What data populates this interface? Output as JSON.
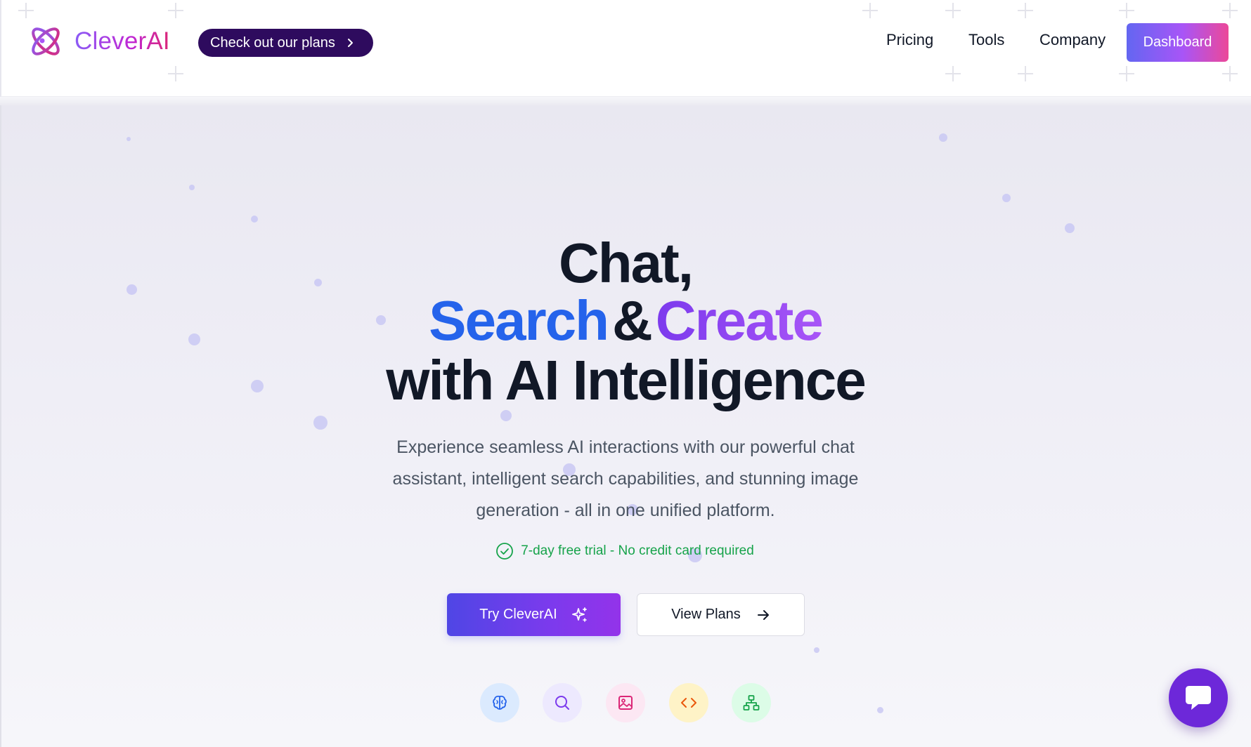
{
  "header": {
    "brand": "CleverAI",
    "plans_pill": "Check out our plans",
    "nav": [
      {
        "label": "Pricing"
      },
      {
        "label": "Tools"
      },
      {
        "label": "Company"
      }
    ],
    "dashboard_label": "Dashboard"
  },
  "hero": {
    "line1": "Chat,",
    "line2_search": "Search",
    "line2_amp": "&",
    "line2_create": "Create",
    "line3": "with AI Intelligence",
    "subtext": "Experience seamless AI interactions with our powerful chat assistant, intelligent search capabilities, and stunning image generation - all in one unified platform.",
    "trial": "7-day free trial - No credit card required",
    "try_button": "Try CleverAI",
    "plans_button": "View Plans"
  },
  "features": [
    {
      "icon": "brain-icon",
      "color": "#2563eb",
      "bg": "#dbeafe"
    },
    {
      "icon": "search-icon",
      "color": "#7c3aed",
      "bg": "#ede9fe"
    },
    {
      "icon": "image-icon",
      "color": "#db2777",
      "bg": "#fce7f3"
    },
    {
      "icon": "code-icon",
      "color": "#ea580c",
      "bg": "#fef3c7"
    },
    {
      "icon": "network-icon",
      "color": "#16a34a",
      "bg": "#dcfce7"
    }
  ],
  "colors": {
    "brand_gradient_start": "#8b5cf6",
    "brand_gradient_end": "#db2777",
    "pill_bg": "#2e0b5e",
    "search_blue": "#2563eb",
    "create_purple": "#9333ea",
    "trial_green": "#16a34a",
    "chat_bubble": "#6d28d9"
  }
}
